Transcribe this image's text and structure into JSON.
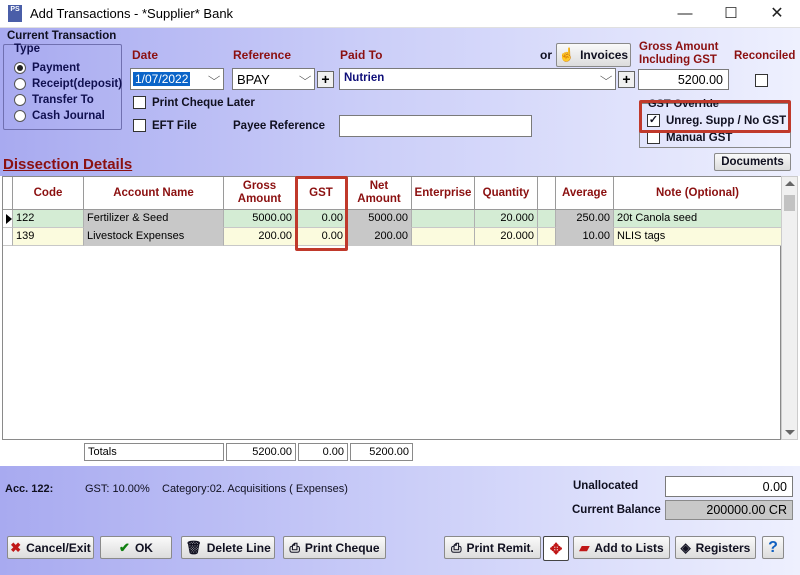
{
  "window": {
    "title": "Add Transactions - *Supplier* Bank",
    "icon_text": "PS",
    "minimize": "—",
    "maximize": "☐",
    "close": "✕"
  },
  "current_transaction": {
    "section_label": "Current Transaction",
    "type_label": "Type",
    "types": [
      "Payment",
      "Receipt(deposit)",
      "Transfer To",
      "Cash Journal"
    ],
    "selected_type": "Payment",
    "date_label": "Date",
    "date_value": "1/07/2022",
    "reference_label": "Reference",
    "reference_value": "BPAY",
    "paid_to_label": "Paid To",
    "paid_to_value": "Nutrien",
    "or_label": "or",
    "invoices_button": "Invoices",
    "gross_amount_label_1": "Gross Amount",
    "gross_amount_label_2": "Including GST",
    "gross_amount_value": "5200.00",
    "reconciled_label": "Reconciled",
    "print_cheque_later": "Print Cheque Later",
    "eft_file": "EFT File",
    "payee_reference_label": "Payee Reference",
    "payee_reference_value": "",
    "gst_override_label": "GST Override",
    "unreg_supp_label": "Unreg. Supp / No GST",
    "manual_gst_label": "Manual GST",
    "documents_button": "Documents"
  },
  "dissection": {
    "title": "Dissection Details",
    "columns": [
      "Code",
      "Account Name",
      "Gross Amount",
      "GST",
      "Net Amount",
      "Enterprise",
      "Quantity",
      "",
      "Average",
      "Note (Optional)"
    ],
    "rows": [
      {
        "code": "122",
        "account": "Fertilizer & Seed",
        "gross": "5000.00",
        "gst": "0.00",
        "net": "5000.00",
        "enterprise": "",
        "quantity": "20.000",
        "average": "250.00",
        "note": "20t Canola seed"
      },
      {
        "code": "139",
        "account": "Livestock Expenses",
        "gross": "200.00",
        "gst": "0.00",
        "net": "200.00",
        "enterprise": "",
        "quantity": "20.000",
        "average": "10.00",
        "note": "NLIS tags"
      }
    ],
    "totals_label": "Totals",
    "totals_gross": "5200.00",
    "totals_gst": "0.00",
    "totals_net": "5200.00"
  },
  "account_info": {
    "account": "Acc. 122:",
    "gst": "GST: 10.00%",
    "category": "Category:02. Acquisitions ( Expenses)",
    "unallocated_label": "Unallocated",
    "unallocated_value": "0.00",
    "current_balance_label": "Current Balance",
    "current_balance_value": "200000.00 CR"
  },
  "buttons": {
    "cancel_exit": "Cancel/Exit",
    "ok": "OK",
    "delete_line": "Delete Line",
    "print_cheque": "Print Cheque",
    "print_remit": "Print Remit.",
    "add_to_lists": "Add to Lists",
    "registers": "Registers",
    "help": "?"
  },
  "colors": {
    "row_selected": "#d4ecd4",
    "row_normal": "#fbfbde",
    "highlight_box": "#c0392b",
    "label_red": "#8b1010",
    "label_navy": "#10107a"
  }
}
